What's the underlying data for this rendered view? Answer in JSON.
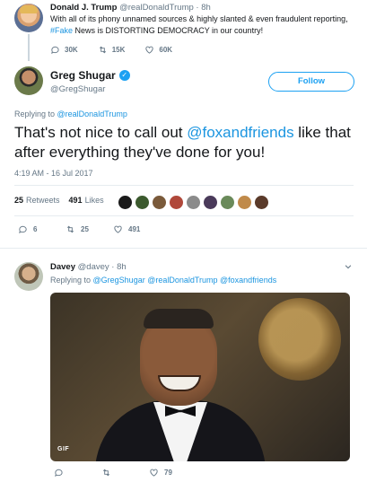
{
  "parent_tweet": {
    "name": "Donald J. Trump",
    "handle": "@realDonaldTrump",
    "time": "· 8h",
    "text_pre": "With all of its phony unnamed sources & highly slanted & even fraudulent reporting, ",
    "hashtag": "#Fake",
    "text_post": " News is DISTORTING DEMOCRACY in our country!",
    "replies": "30K",
    "retweets": "15K",
    "likes": "60K"
  },
  "main_tweet": {
    "name": "Greg Shugar",
    "handle": "@GregShugar",
    "follow_label": "Follow",
    "replying_prefix": "Replying to ",
    "replying_to": "@realDonaldTrump",
    "text_pre": "That's not nice to call out ",
    "mention": "@foxandfriends",
    "text_post": " like that after everything they've done for you!",
    "timestamp": "4:19 AM - 16 Jul 2017",
    "retweet_count": "25",
    "retweet_label": "Retweets",
    "like_count": "491",
    "like_label": "Likes",
    "replies": "6",
    "retweets": "25",
    "likes": "491"
  },
  "reply_tweet": {
    "name": "Davey",
    "handle": "@davey",
    "time": "· 8h",
    "replying_prefix": "Replying to ",
    "replying_to": "@GregShugar @realDonaldTrump @foxandfriends",
    "gif_badge": "GIF",
    "likes": "79"
  },
  "colors": {
    "accent": "#1da1f2",
    "link": "#1b95e0",
    "muted": "#657786",
    "divider": "#e6ecf0"
  },
  "icons": [
    "reply-icon",
    "retweet-icon",
    "like-icon",
    "verified-icon",
    "chevron-down-icon"
  ]
}
